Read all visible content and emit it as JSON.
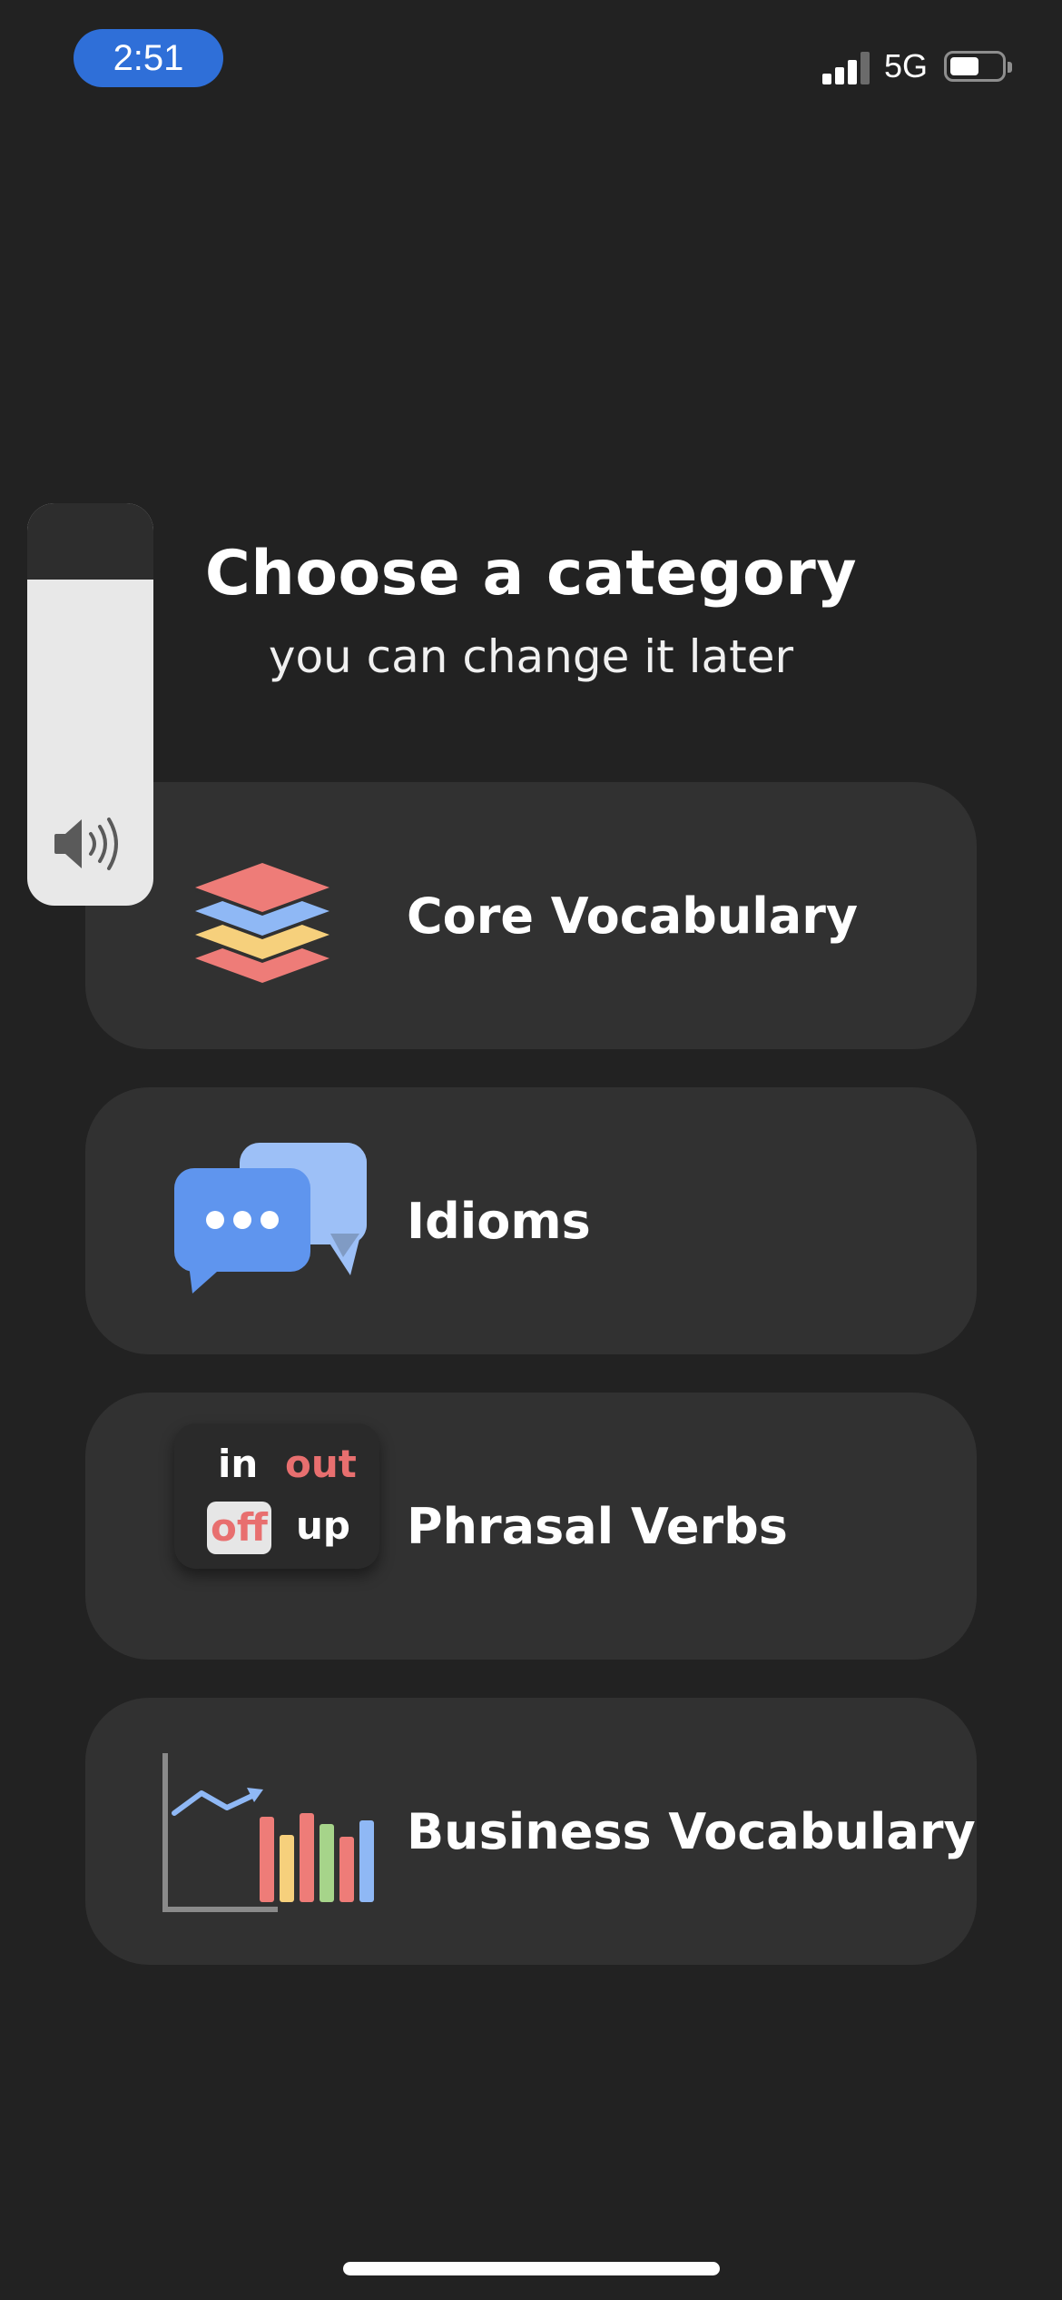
{
  "status_bar": {
    "time": "2:51",
    "network": "5G",
    "battery_level": 0.55,
    "signal_bars": 3,
    "signal_max": 4,
    "signal_icon": "cellular-signal-icon",
    "battery_icon": "battery-icon"
  },
  "header": {
    "title": "Choose a category",
    "subtitle": "you can change it later"
  },
  "categories": [
    {
      "label": "Core Vocabulary",
      "icon": "layers-stack-icon"
    },
    {
      "label": "Idioms",
      "icon": "chat-bubbles-icon"
    },
    {
      "label": "Phrasal Verbs",
      "icon": "phrasal-verbs-tile-icon",
      "tile_words": [
        "in",
        "out",
        "off",
        "up"
      ]
    },
    {
      "label": "Business Vocabulary",
      "icon": "bar-chart-icon"
    }
  ],
  "volume_hud": {
    "level": 0.81,
    "icon": "speaker-icon"
  },
  "colors": {
    "background": "#222222",
    "card": "#313131",
    "accent_blue": "#2f6fd8",
    "red": "#ee7c78",
    "blue": "#8fb8f5",
    "yellow": "#f6d07c"
  }
}
